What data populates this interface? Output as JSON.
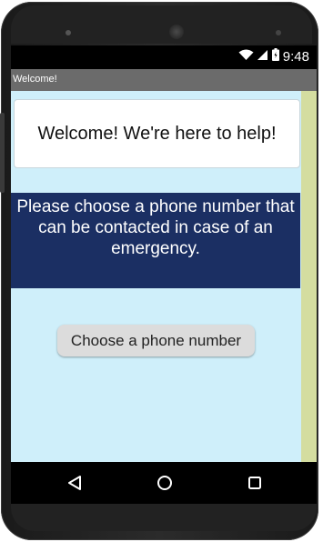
{
  "status_bar": {
    "time": "9:48",
    "icons": [
      "wifi-icon",
      "signal-icon",
      "battery-icon"
    ]
  },
  "app": {
    "title": "Welcome!"
  },
  "main": {
    "welcome_text": "Welcome! We're here to help!",
    "info_text": "Please choose a phone number that can be contacted in case of an emergency.",
    "choose_button_label": "Choose a phone number"
  },
  "nav_bar": {
    "icons": [
      "back-icon",
      "home-icon",
      "recent-apps-icon"
    ]
  },
  "colors": {
    "screen_bg": "#cfeffa",
    "info_panel_bg": "#1b2f63",
    "title_bar_bg": "#6b6b6b",
    "right_strip": "#d4dda0"
  }
}
